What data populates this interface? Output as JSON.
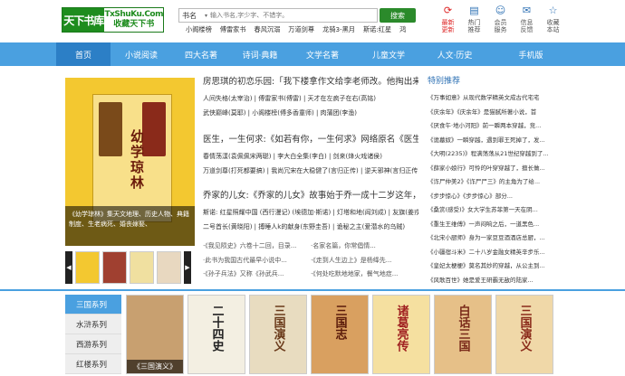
{
  "logo": {
    "left": "天下书库",
    "right_a": "TxShuKu.Com",
    "right_b": "收藏天下书"
  },
  "search": {
    "category": "书名",
    "placeholder": "输入书名,字少字、不错字。",
    "button": "搜索"
  },
  "hot_links": [
    "小阁楼榜",
    "傅雷家书",
    "春风沉溺",
    "万道剑尊",
    "龙骑3-黑月",
    "斯诺:红星",
    "鸿"
  ],
  "tools": [
    {
      "label1": "最新",
      "label2": "更新",
      "icon": "refresh-icon",
      "highlight": true
    },
    {
      "label1": "热门",
      "label2": "推荐",
      "icon": "chart-icon",
      "highlight": false
    },
    {
      "label1": "会员",
      "label2": "服务",
      "icon": "user-icon",
      "highlight": false
    },
    {
      "label1": "信息",
      "label2": "反馈",
      "icon": "message-icon",
      "highlight": false
    },
    {
      "label1": "收藏",
      "label2": "本站",
      "icon": "star-icon",
      "highlight": false
    }
  ],
  "nav": [
    "首页",
    "小说阅读",
    "四大名著",
    "诗词·典籍",
    "文学名著",
    "儿童文学",
    "人文·历史",
    "手机版"
  ],
  "banner": {
    "title": "幼学琼林",
    "caption": "《幼学琼林》集天文地理、历史人物、典籍制度、生老病死、婚丧嫁娶、"
  },
  "features": [
    {
      "headline": "房思琪的初恋乐园:「我下楼拿作文给李老师改。他掏出来，",
      "lines": [
        "人间失格(太宰治) | 傅雷家书(傅雷) | 天才在左疯子在右(高铭)",
        "武侠巅峰(莫耶) | 小阁楼榜(傅多香童师) | 肉蒲团(李渔)"
      ]
    },
    {
      "headline": "医生，一生何求:《如若有你，一生何求》网络原名《医生，",
      "lines": [
        "春情荡漾(袁佩佩宋两聪) | 李大白全集(李白) | 剑来(烽火戏诸侯)",
        "万道剑尊(打死都要搞) | 我尚冗宋在大稳健了(言归正传) | 逆天邪神(言归正传)"
      ]
    },
    {
      "headline": "乔家的儿女:《乔家的儿女》故事始于乔一成十二岁这年，",
      "lines": [
        "斯诺: 红星照耀中国 (西行漫记) (埃德加·斯诺) | 灯塔和地(阎刘成) | 友旗(姜戎)",
        "二号首长(黄晓阳) | 搏睡人k的献身(东野圭吾) | 诡秘之主(爱潜水的乌贼)"
      ]
    }
  ],
  "list_rows": [
    [
      "·《我见陨史》六卷十二回，目录...",
      "·名家名篇，你常倡情..."
    ],
    [
      "·此书为我国古代最早小说中...",
      "·《走到人生边上》是杨绛先..."
    ],
    [
      "·《孙子兵法》又称《孙武兵...",
      "·《何处吃默地地家，餐气地症..."
    ]
  ],
  "recommend": {
    "title": "特别推荐",
    "items": [
      "《万事如意》从现代数学精英文成古代宅宅",
      "《庆余年》《庆余年》是猫腻所著小说，首",
      "《厌食午·地小河阳》前一瞬两本穿越，竞...",
      "《诡墓奴》一瞬穿越，遇到罪王死掉了，发...",
      "《大明(2235)》程满荡荡从21世纪穿越到了...",
      "《薛家小娘行》可怜的叶穿穿越了，擅长做...",
      "《诈尸仲美2》《诈尸尸三》的主角为了给...",
      "《步步惊心》《步步惊心》部分...",
      "《桑赏(感受)》女大学生苏菲第一天在阴...",
      "《重生王维傅》一声闷响之后，一道黑色...",
      "《北宋小厨师》身为一家豆豆酒酒店总厨，...",
      "《小疆宿斗米》二十八岁金融女精英辛步乐...",
      "《皇妃太梗梗》莫名其妙的穿越，从公主到...",
      "《风歌百世》她是爱王研霸无敌的陆家..."
    ]
  },
  "series": [
    "三国系列",
    "水浒系列",
    "西游系列",
    "红楼系列"
  ],
  "covers": [
    {
      "title": "",
      "caption": "《三国演义》",
      "bg": "#c8a070",
      "fg": "#8a1a1a"
    },
    {
      "title": "二十四史",
      "caption": "",
      "bg": "#f3efe2",
      "fg": "#222"
    },
    {
      "title": "三国演义",
      "caption": "",
      "bg": "#e8dcc0",
      "fg": "#6a3a1a"
    },
    {
      "title": "三国志",
      "caption": "",
      "bg": "#d9a060",
      "fg": "#5a1a0a"
    },
    {
      "title": "诸葛亮传",
      "caption": "",
      "bg": "#f5e0a0",
      "fg": "#a02020"
    },
    {
      "title": "白话三国",
      "caption": "",
      "bg": "#e6c088",
      "fg": "#7a2a1a"
    },
    {
      "title": "三国演义",
      "caption": "",
      "bg": "#f0d8a8",
      "fg": "#8a2a1a"
    }
  ]
}
